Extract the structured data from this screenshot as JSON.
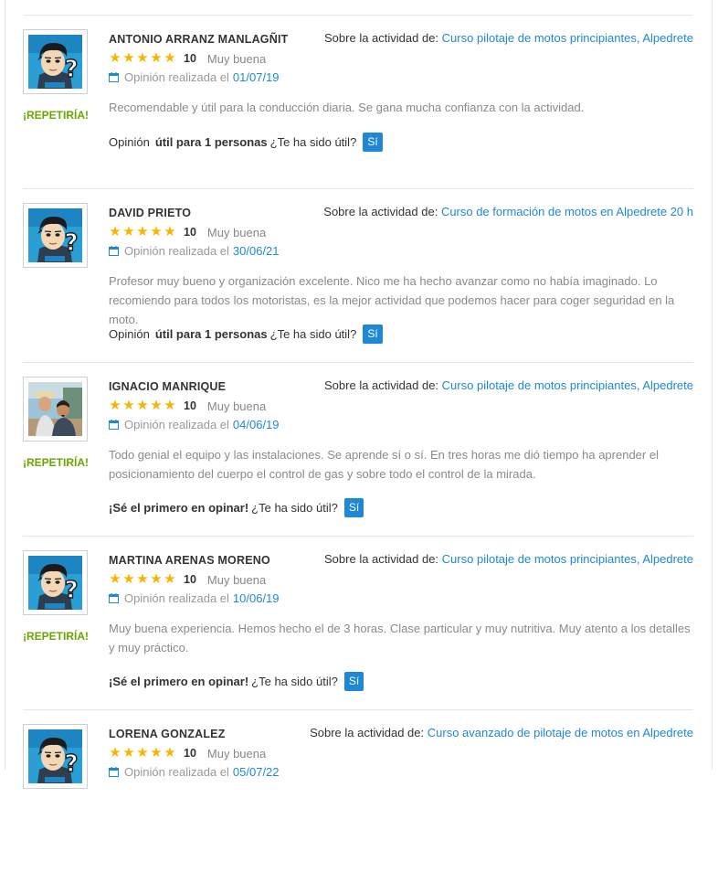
{
  "labels": {
    "activity_prefix": "Sobre la actividad de:",
    "date_prefix": "Opinión realizada el",
    "useful_pre": "Opinión",
    "useful_question": "¿Te ha sido útil?",
    "first_to_opine": "¡Sé el primero en opinar!",
    "yes_button": "Sí",
    "repeat": "¡REPETIRÍA!"
  },
  "colors": {
    "accent": "#1e88d6",
    "star": "#f7b500",
    "repeat": "#6aa600"
  },
  "reviews": [
    {
      "name": "ANTONIO ARRANZ MANLAGÑIT",
      "activity": "Curso pilotaje de motos principiantes, Alpedrete",
      "score": "10",
      "stars": 5,
      "quality": "Muy buena",
      "date": "01/07/19",
      "comment": "Recomendable y útil para la conducción diaria. Se gana mucha confianza con la actividad.",
      "useful_count_text": "útil para 1 personas",
      "repeat": true,
      "avatar": "cartoon-avatar-icon"
    },
    {
      "name": "DAVID PRIETO",
      "activity": "Curso de formación de motos en Alpedrete 20 h",
      "score": "10",
      "stars": 5,
      "quality": "Muy buena",
      "date": "30/06/21",
      "comment": "Profesor muy bueno y organización excelente. Nico me ha hecho avanzar como no había imaginado. Lo recomiendo para todos los motoristas, es la mejor actividad que podemos hacer para coger seguridad en la moto.",
      "useful_count_text": "útil para 1 personas",
      "repeat": false,
      "avatar": "cartoon-avatar-icon"
    },
    {
      "name": "IGNACIO MANRIQUE",
      "activity": "Curso pilotaje de motos principiantes, Alpedrete",
      "score": "10",
      "stars": 5,
      "quality": "Muy buena",
      "date": "04/06/19",
      "comment": "Todo genial el equipo y las instalaciones. Se aprende sí o sí. En tres horas me dió tiempo ha aprender el posicionamiento del cuerpo el control de gas y sobre todo el control de la mirada.",
      "useful_count_text": "",
      "repeat": true,
      "avatar": "user-photo"
    },
    {
      "name": "MARTINA ARENAS MORENO",
      "activity": "Curso pilotaje de motos principiantes, Alpedrete",
      "score": "10",
      "stars": 5,
      "quality": "Muy buena",
      "date": "10/06/19",
      "comment": "Muy buena experiencia. Hemos hecho el de 3 horas. Clase particular y muy nutritiva. Muy atento a los detalles y muy práctico.",
      "useful_count_text": "",
      "repeat": true,
      "avatar": "cartoon-avatar-icon"
    },
    {
      "name": "LORENA GONZALEZ",
      "activity": "Curso avanzado de pilotaje de motos en Alpedrete",
      "score": "10",
      "stars": 5,
      "quality": "Muy buena",
      "date": "05/07/22",
      "comment": "",
      "useful_count_text": "",
      "repeat": false,
      "avatar": "cartoon-avatar-icon"
    }
  ]
}
